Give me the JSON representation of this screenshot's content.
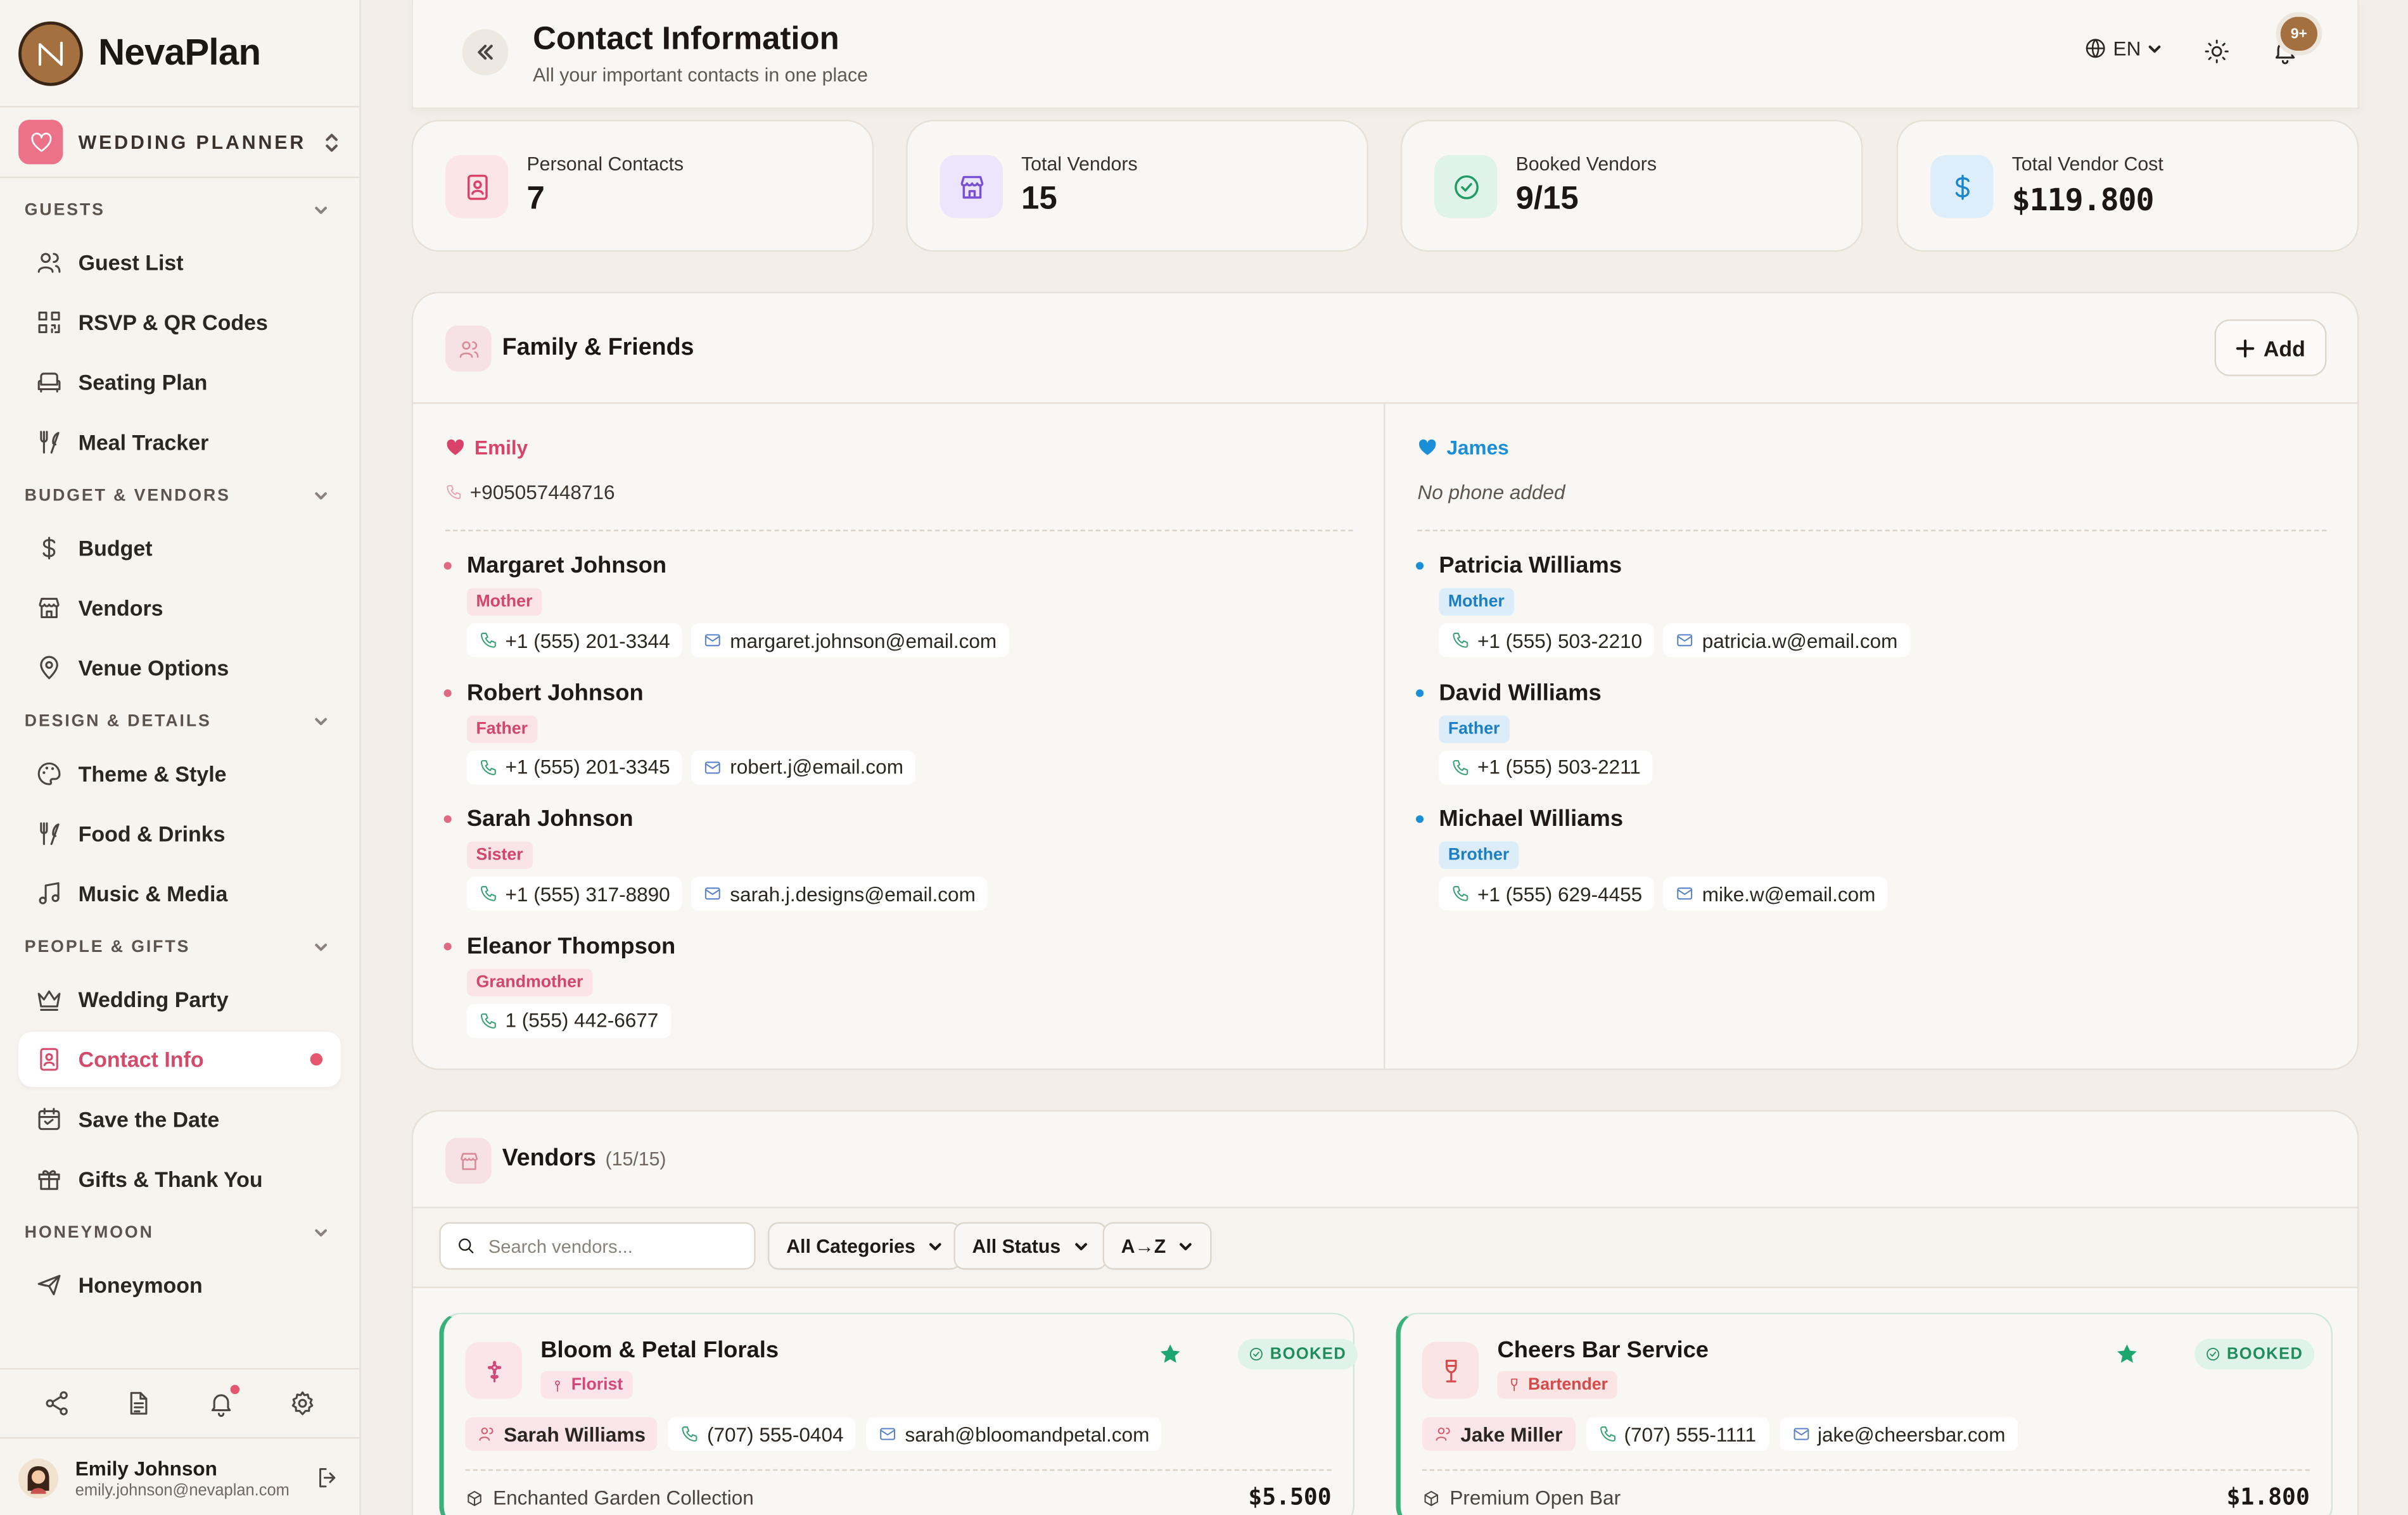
{
  "app": {
    "name": "NevaPlan"
  },
  "workspace": {
    "name": "WEDDING PLANNER"
  },
  "sidebar": {
    "sections": [
      {
        "title": "GUESTS",
        "items": [
          {
            "label": "Guest List",
            "icon": "users-icon"
          },
          {
            "label": "RSVP & QR Codes",
            "icon": "qr-code-icon"
          },
          {
            "label": "Seating Plan",
            "icon": "sofa-icon"
          },
          {
            "label": "Meal Tracker",
            "icon": "utensils-icon"
          }
        ]
      },
      {
        "title": "BUDGET & VENDORS",
        "items": [
          {
            "label": "Budget",
            "icon": "dollar-icon"
          },
          {
            "label": "Vendors",
            "icon": "store-icon"
          },
          {
            "label": "Venue Options",
            "icon": "map-pin-icon"
          }
        ]
      },
      {
        "title": "DESIGN & DETAILS",
        "items": [
          {
            "label": "Theme & Style",
            "icon": "palette-icon"
          },
          {
            "label": "Food & Drinks",
            "icon": "utensils-icon"
          },
          {
            "label": "Music & Media",
            "icon": "music-icon"
          }
        ]
      },
      {
        "title": "PEOPLE & GIFTS",
        "items": [
          {
            "label": "Wedding Party",
            "icon": "crown-icon"
          },
          {
            "label": "Contact Info",
            "icon": "contact-book-icon",
            "active": true
          },
          {
            "label": "Save the Date",
            "icon": "calendar-icon"
          },
          {
            "label": "Gifts & Thank You",
            "icon": "gift-icon"
          }
        ]
      },
      {
        "title": "HONEYMOON",
        "items": [
          {
            "label": "Honeymoon",
            "icon": "plane-icon"
          }
        ]
      }
    ]
  },
  "user": {
    "name": "Emily Johnson",
    "email": "emily.johnson@nevaplan.com"
  },
  "header": {
    "title": "Contact Information",
    "subtitle": "All your important contacts in one place",
    "language": "EN",
    "notification_badge": "9+"
  },
  "stats": [
    {
      "label": "Personal Contacts",
      "value": "7"
    },
    {
      "label": "Total Vendors",
      "value": "15"
    },
    {
      "label": "Booked Vendors",
      "value": "9/15"
    },
    {
      "label": "Total Vendor Cost",
      "value": "$119.800"
    }
  ],
  "family": {
    "title": "Family & Friends",
    "add_label": "Add",
    "sides": [
      {
        "name": "Emily",
        "phone": "+905057448716",
        "color": "#d9436a",
        "members": [
          {
            "name": "Margaret Johnson",
            "role": "Mother",
            "phone": "+1 (555) 201-3344",
            "email": "margaret.johnson@email.com"
          },
          {
            "name": "Robert Johnson",
            "role": "Father",
            "phone": "+1 (555) 201-3345",
            "email": "robert.j@email.com"
          },
          {
            "name": "Sarah Johnson",
            "role": "Sister",
            "phone": "+1 (555) 317-8890",
            "email": "sarah.j.designs@email.com"
          },
          {
            "name": "Eleanor Thompson",
            "role": "Grandmother",
            "phone": "1 (555) 442-6677",
            "email": ""
          }
        ]
      },
      {
        "name": "James",
        "phone": "No phone added",
        "color": "#1a8ed6",
        "members": [
          {
            "name": "Patricia Williams",
            "role": "Mother",
            "phone": "+1 (555) 503-2210",
            "email": "patricia.w@email.com"
          },
          {
            "name": "David Williams",
            "role": "Father",
            "phone": "+1 (555) 503-2211",
            "email": ""
          },
          {
            "name": "Michael Williams",
            "role": "Brother",
            "phone": "+1 (555) 629-4455",
            "email": "mike.w@email.com"
          }
        ]
      }
    ]
  },
  "vendors": {
    "title": "Vendors",
    "count": "(15/15)",
    "search_placeholder": "Search vendors...",
    "filters": {
      "category": "All Categories",
      "status": "All Status",
      "sort": "A→Z"
    },
    "items": [
      {
        "name": "Bloom & Petal Florals",
        "category": "Florist",
        "status": "BOOKED",
        "contact": "Sarah Williams",
        "phone": "(707) 555-0404",
        "email": "sarah@bloomandpetal.com",
        "package": "Enchanted Garden Collection",
        "price": "$5.500"
      },
      {
        "name": "Cheers Bar Service",
        "category": "Bartender",
        "status": "BOOKED",
        "contact": "Jake Miller",
        "phone": "(707) 555-1111",
        "email": "jake@cheersbar.com",
        "package": "Premium Open Bar",
        "price": "$1.800"
      }
    ]
  },
  "colors": {
    "accent": "#d24b6a",
    "brand": "#a5703f",
    "booked": "#1f8c5c"
  }
}
